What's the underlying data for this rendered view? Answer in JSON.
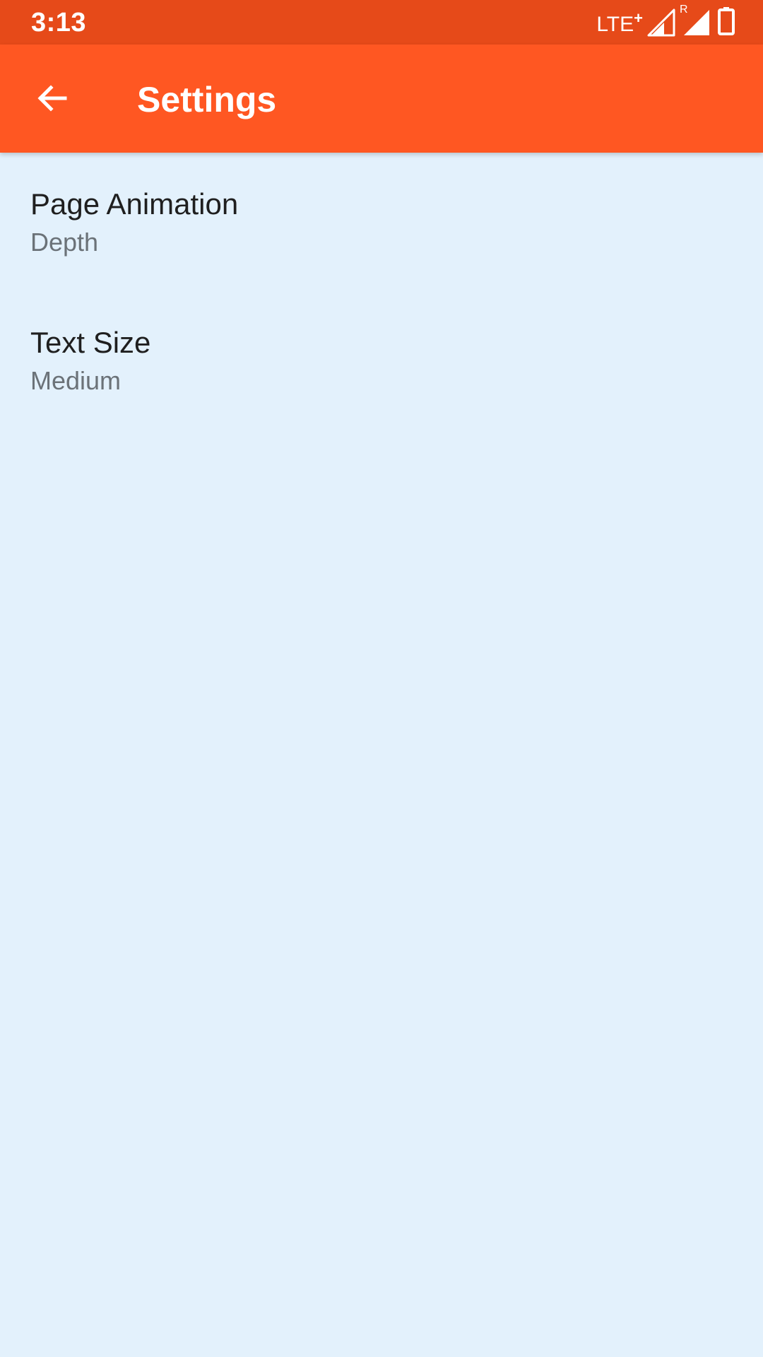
{
  "status_bar": {
    "time": "3:13",
    "network": "LTE",
    "network_suffix": "+",
    "roaming": "R",
    "icons": [
      "signal-icon",
      "signal-roaming-icon",
      "battery-icon"
    ],
    "color": "#E64A19"
  },
  "app_bar": {
    "title": "Settings",
    "back_icon": "arrow-left-icon",
    "color": "#FF5722"
  },
  "settings": [
    {
      "title": "Page Animation",
      "value": "Depth"
    },
    {
      "title": "Text Size",
      "value": "Medium"
    }
  ],
  "colors": {
    "background": "#E3F1FC",
    "title_text": "#1F1F1F",
    "summary_text": "#6B7278"
  }
}
